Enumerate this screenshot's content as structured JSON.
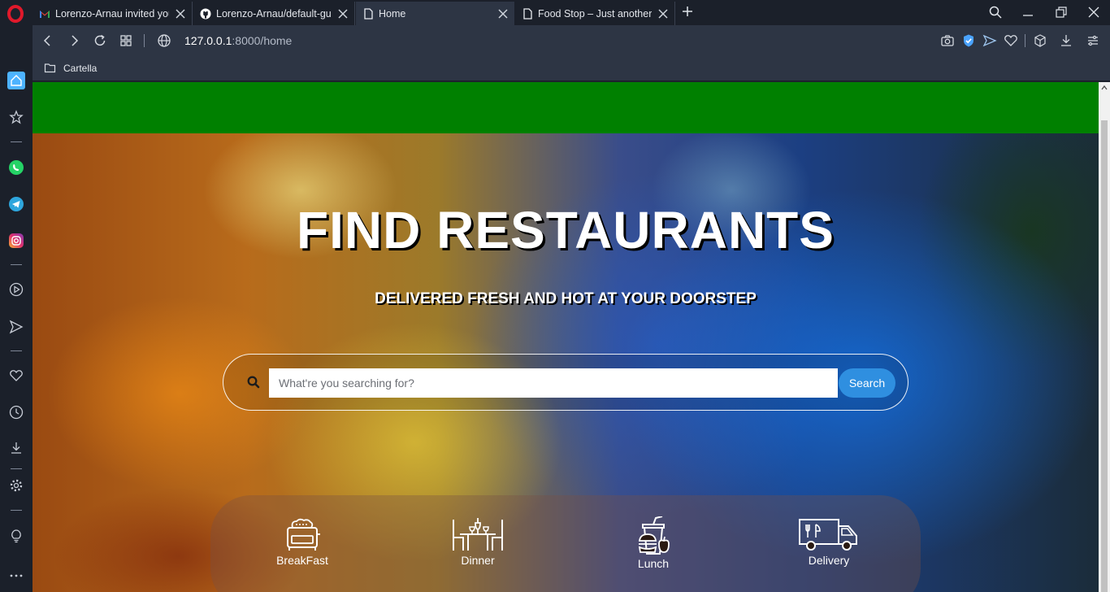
{
  "browser": {
    "tabs": [
      {
        "title": "Lorenzo-Arnau invited you",
        "favicon": "gmail-icon"
      },
      {
        "title": "Lorenzo-Arnau/default-gui",
        "favicon": "github-icon"
      },
      {
        "title": "Home",
        "favicon": "page-icon",
        "active": true
      },
      {
        "title": "Food Stop – Just another W",
        "favicon": "page-icon"
      }
    ],
    "url": {
      "host": "127.0.0.1",
      "path": ":8000/home"
    },
    "bookmarks": [
      {
        "label": "Cartella",
        "icon": "folder-icon"
      }
    ],
    "colors": {
      "tabbar": "#1b202a",
      "toolbar": "#2d3544",
      "shield": "#4aa3ff"
    }
  },
  "page": {
    "hero": {
      "title": "FIND RESTAURANTS",
      "subtitle": "DELIVERED FRESH AND HOT AT YOUR DOORSTEP"
    },
    "search": {
      "placeholder": "What're you searching for?",
      "value": "",
      "button_label": "Search"
    },
    "categories": [
      {
        "label": "BreakFast",
        "icon": "toaster-icon"
      },
      {
        "label": "Dinner",
        "icon": "dining-table-icon"
      },
      {
        "label": "Lunch",
        "icon": "burger-drink-icon"
      },
      {
        "label": "Delivery",
        "icon": "food-truck-icon"
      }
    ],
    "colors": {
      "header_bar": "#008000",
      "search_button": "#2f8fe0"
    }
  }
}
